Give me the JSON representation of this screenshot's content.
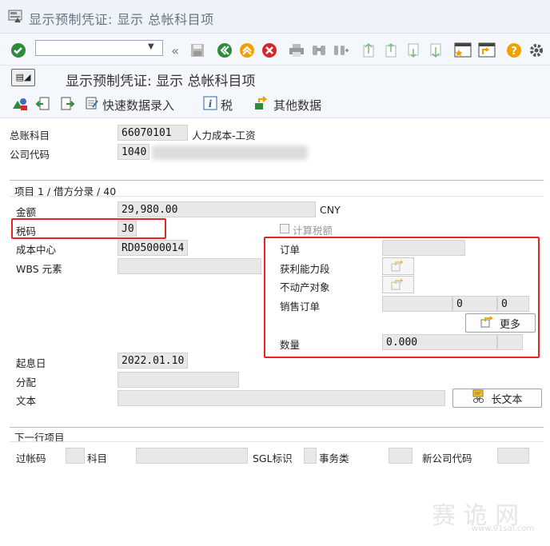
{
  "window": {
    "title": "显示预制凭证: 显示 总帐科目项"
  },
  "screen": {
    "title": "显示预制凭证: 显示 总帐科目项"
  },
  "toolbar2": {
    "quick_entry": "快速数据录入",
    "tax": "税",
    "other_data": "其他数据"
  },
  "header": {
    "gl_account_label": "总账科目",
    "gl_account_value": "66070101",
    "gl_account_desc": "人力成本-工资",
    "company_code_label": "公司代码",
    "company_code_value": "1040"
  },
  "item": {
    "section_title": "项目 1 / 借方分录 / 40",
    "amount_label": "金额",
    "amount_value": "29,980.00",
    "currency": "CNY",
    "tax_code_label": "税码",
    "tax_code_value": "J0",
    "calc_tax_label": "计算税额",
    "cost_center_label": "成本中心",
    "cost_center_value": "RD05000014",
    "wbs_label": "WBS 元素",
    "order_label": "订单",
    "profit_seg_label": "获利能力段",
    "real_estate_label": "不动产对象",
    "sales_order_label": "销售订单",
    "sales_order_item": "0",
    "sales_order_sched": "0",
    "more_label": "更多",
    "quantity_label": "数量",
    "quantity_value": "0.000",
    "value_date_label": "起息日",
    "value_date_value": "2022.01.10",
    "assignment_label": "分配",
    "text_label": "文本",
    "long_text_label": "长文本"
  },
  "next_item": {
    "section_title": "下一行项目",
    "posting_key_label": "过帐码",
    "account_label": "科目",
    "sgl_label": "SGL标识",
    "trans_type_label": "事务类",
    "new_company_label": "新公司代码"
  },
  "watermark": {
    "text": "赛 诡 网",
    "url": "www.91sai.com"
  },
  "colors": {
    "highlight_red": "#e8261f",
    "accent_green": "#2e8b3a",
    "accent_orange": "#f0a000"
  }
}
